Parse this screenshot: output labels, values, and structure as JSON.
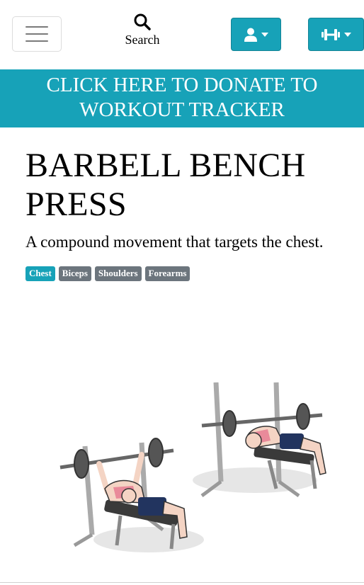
{
  "nav": {
    "search_label": "Search",
    "icons": {
      "menu": "hamburger-icon",
      "search": "search-icon",
      "user": "user-icon",
      "gym": "dumbbell-icon"
    }
  },
  "banner": {
    "line1": "CLICK HERE TO DONATE TO",
    "line2": "WORKOUT TRACKER"
  },
  "exercise": {
    "title_line1": "BARBELL BENCH",
    "title_line2": "PRESS",
    "description": "A compound movement that targets the chest.",
    "muscles": [
      {
        "label": "Chest",
        "type": "primary"
      },
      {
        "label": "Biceps",
        "type": "secondary"
      },
      {
        "label": "Shoulders",
        "type": "secondary"
      },
      {
        "label": "Forearms",
        "type": "secondary"
      }
    ]
  },
  "colors": {
    "accent": "#17a2b8",
    "secondary": "#6c757d"
  }
}
